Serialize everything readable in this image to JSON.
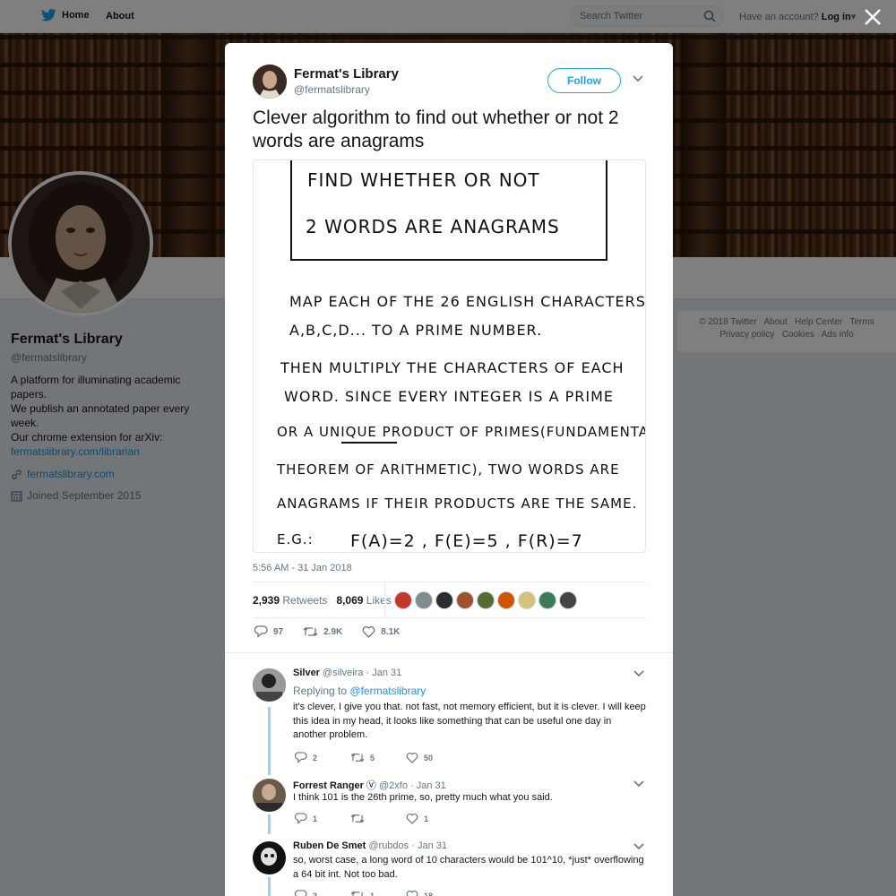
{
  "nav": {
    "home_label": "Home",
    "about_label": "About",
    "search_placeholder": "Search Twitter",
    "have_account": "Have an account?",
    "login_label": "Log in"
  },
  "profile": {
    "name": "Fermat's Library",
    "handle": "@fermatslibrary",
    "bio_lines": [
      "A platform for illuminating academic papers.",
      "We publish an annotated paper every week.",
      "Our chrome extension for arXiv:"
    ],
    "bio_link": "fermatslibrary.com/librarian",
    "website": "fermatslibrary.com",
    "joined": "Joined September 2015"
  },
  "footer": {
    "copyright": "© 2018 Twitter",
    "about": "About",
    "help": "Help Center",
    "terms": "Terms",
    "privacy": "Privacy policy",
    "cookies": "Cookies",
    "ads": "Ads info"
  },
  "tweet": {
    "author_name": "Fermat's Library",
    "author_handle": "@fermatslibrary",
    "follow_label": "Follow",
    "text": "Clever algorithm to find out whether or not 2 words are anagrams",
    "image_lines": [
      "FIND WHETHER OR NOT",
      "2 WORDS ARE ANAGRAMS",
      "MAP EACH OF THE 26 ENGLISH CHARACTERS",
      "A,B,C,D... TO A PRIME NUMBER.",
      "THEN MULTIPLY THE CHARACTERS OF EACH",
      "WORD. SINCE EVERY INTEGER IS A PRIME",
      "OR A UNIQUE PRODUCT OF PRIMES(FUNDAMENTAL",
      "THEOREM OF ARITHMETIC), TWO WORDS ARE",
      "ANAGRAMS IF THEIR PRODUCTS ARE THE SAME.",
      "E.G.:",
      "F(A)=2 , F(E)=5 , F(R)=7"
    ],
    "timestamp": "5:56 AM - 31 Jan 2018",
    "retweets_count": "2,939",
    "retweets_label": "Retweets",
    "likes_count": "8,069",
    "likes_label": "Likes",
    "reply_count": "97",
    "retweet_short": "2.9K",
    "like_short": "8.1K"
  },
  "likers": [
    {
      "color": "#c0392b"
    },
    {
      "color": "#7f8c8d"
    },
    {
      "color": "#2c2c2c"
    },
    {
      "color": "#a0522d"
    },
    {
      "color": "#556b2f"
    },
    {
      "color": "#d35400"
    },
    {
      "color": "#d4c27a"
    },
    {
      "color": "#3d7a5a"
    },
    {
      "color": "#444444"
    }
  ],
  "replies": [
    {
      "name": "Silver",
      "handle": "@silveira",
      "date": "· Jan 31",
      "replying_prefix": "Replying to",
      "replying_to": "@fermatslibrary",
      "body": "it's clever, I give you that. not fast, not memory efficient, but it is clever. I will keep this idea in my head, it looks like something that can be useful one day in another problem.",
      "replies": "2",
      "retweets": "5",
      "likes": "50",
      "avatar_color": "#888888"
    },
    {
      "name": "Forrest Ranger",
      "verified_mark": "Ⓥ",
      "handle": "@2xfo",
      "date": "· Jan 31",
      "body": "I think 101 is the 26th prime, so, pretty much what you said.",
      "replies": "1",
      "retweets": "",
      "likes": "1",
      "avatar_color": "#5a4a3a"
    },
    {
      "name": "Ruben De Smet",
      "handle": "@rubdos",
      "date": "· Jan 31",
      "body": "so, worst case, a long word of 10 characters would be 101^10, *just* overflowing a 64 bit int. Not too bad.",
      "replies": "2",
      "retweets": "1",
      "likes": "18",
      "avatar_color": "#222222"
    }
  ],
  "colors": {
    "accent": "#1da1f2",
    "link": "#1b95e0",
    "muted": "#657786"
  }
}
